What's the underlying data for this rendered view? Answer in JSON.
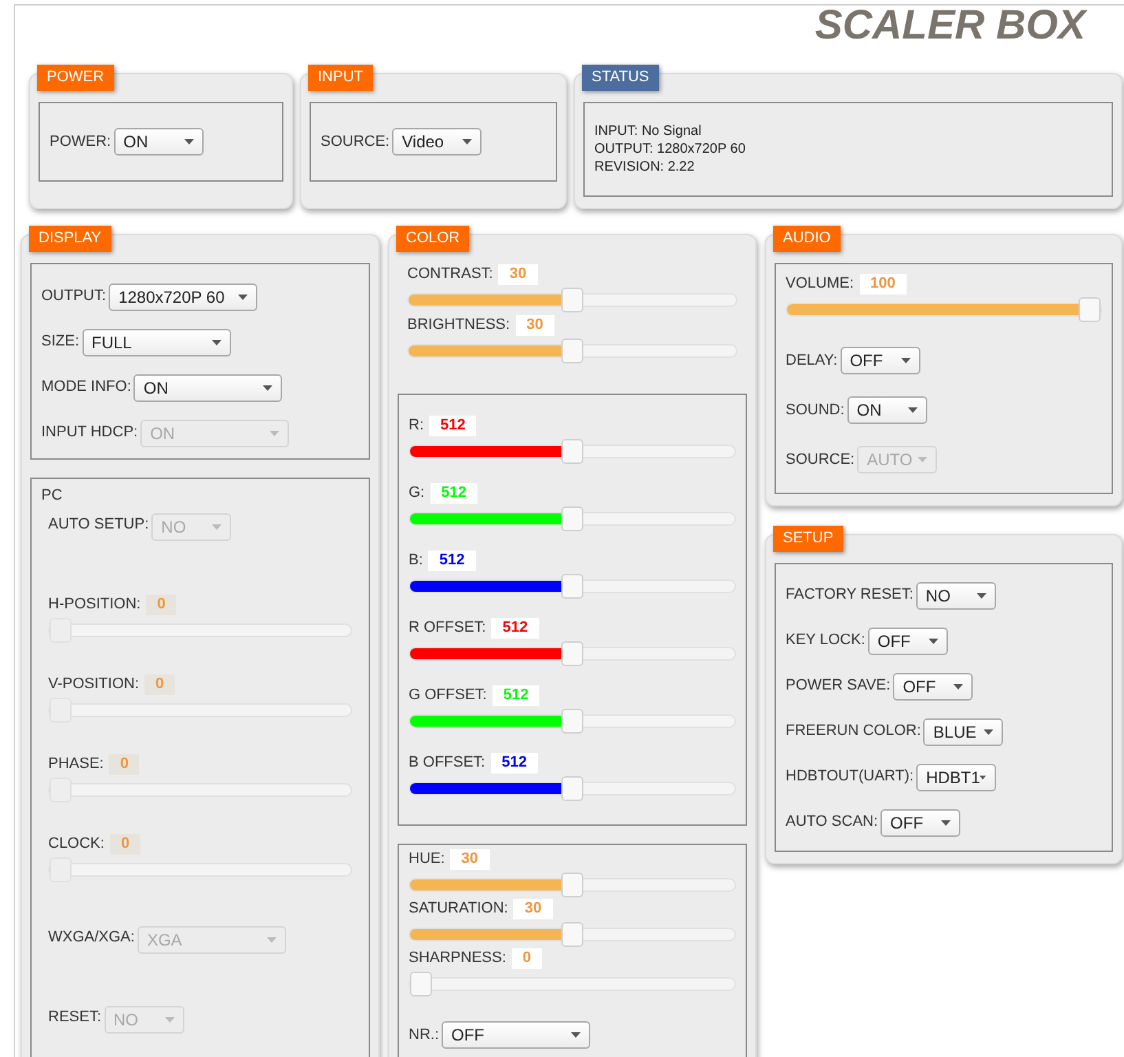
{
  "title": "SCALER BOX",
  "panels": [
    {
      "heading": "POWER",
      "color": "#ff6a00",
      "groups": [
        {
          "kind": "boxed",
          "rows": [
            {
              "kind": "select",
              "label": "POWER:",
              "value": "ON",
              "disabled": false
            }
          ]
        }
      ]
    },
    {
      "heading": "INPUT",
      "color": "#ff6a00",
      "groups": [
        {
          "kind": "boxed",
          "rows": [
            {
              "kind": "select",
              "label": "SOURCE:",
              "value": "Video",
              "disabled": false
            }
          ]
        }
      ]
    },
    {
      "heading": "STATUS",
      "color": "#4c6d9e",
      "groups": [
        {
          "kind": "boxed",
          "rows": [
            {
              "kind": "text",
              "label": "INPUT: No Signal"
            },
            {
              "kind": "text",
              "label": "OUTPUT: 1280x720P 60"
            },
            {
              "kind": "text",
              "label": "REVISION: 2.22"
            }
          ]
        }
      ]
    },
    {
      "heading": "DISPLAY",
      "color": "#ff6a00",
      "groups": [
        {
          "kind": "boxed",
          "rows": [
            {
              "kind": "select",
              "label": "OUTPUT:",
              "value": "1280x720P 60",
              "disabled": false
            },
            {
              "kind": "select",
              "label": "SIZE:",
              "value": "FULL",
              "disabled": false
            },
            {
              "kind": "select",
              "label": "MODE INFO:",
              "value": "ON",
              "disabled": false
            },
            {
              "kind": "select",
              "label": "INPUT HDCP:",
              "value": "ON",
              "disabled": true
            }
          ]
        },
        {
          "kind": "boxed",
          "title": "PC",
          "rows": [
            {
              "kind": "select",
              "label": "AUTO SETUP:",
              "value": "NO",
              "disabled": true
            },
            {
              "kind": "slider",
              "label": "H-POSITION:",
              "value": "0",
              "level": 0,
              "disabled": true
            },
            {
              "kind": "slider",
              "label": "V-POSITION:",
              "value": "0",
              "level": 0,
              "disabled": true
            },
            {
              "kind": "slider",
              "label": "PHASE:",
              "value": "0",
              "level": 0,
              "disabled": true
            },
            {
              "kind": "slider",
              "label": "CLOCK:",
              "value": "0",
              "level": 0,
              "disabled": true
            },
            {
              "kind": "select",
              "label": "WXGA/XGA:",
              "value": "XGA",
              "disabled": true
            },
            {
              "kind": "select",
              "label": "RESET:",
              "value": "NO",
              "disabled": true
            }
          ]
        }
      ]
    },
    {
      "heading": "COLOR",
      "color": "#ff6a00",
      "groups": [
        {
          "kind": "open",
          "rows": [
            {
              "kind": "slider",
              "label": "CONTRAST:",
              "value": "30",
              "level": 0.5,
              "color": "#f5b553",
              "disabled": false
            },
            {
              "kind": "slider",
              "label": "BRIGHTNESS:",
              "value": "30",
              "level": 0.5,
              "color": "#f5b553",
              "disabled": false
            }
          ]
        },
        {
          "kind": "boxed",
          "rows": [
            {
              "kind": "slider",
              "label": "R:",
              "value": "512",
              "level": 0.5,
              "color": "#ff0000",
              "disabled": false
            },
            {
              "kind": "slider",
              "label": "G:",
              "value": "512",
              "level": 0.5,
              "color": "#00ff00",
              "disabled": false
            },
            {
              "kind": "slider",
              "label": "B:",
              "value": "512",
              "level": 0.5,
              "color": "#0000ff",
              "disabled": false
            },
            {
              "kind": "slider",
              "label": "R OFFSET:",
              "value": "512",
              "level": 0.5,
              "color": "#ff0000",
              "disabled": false
            },
            {
              "kind": "slider",
              "label": "G OFFSET:",
              "value": "512",
              "level": 0.5,
              "color": "#00ff00",
              "disabled": false
            },
            {
              "kind": "slider",
              "label": "B OFFSET:",
              "value": "512",
              "level": 0.5,
              "color": "#0000ff",
              "disabled": false
            }
          ]
        },
        {
          "kind": "boxed",
          "rows": [
            {
              "kind": "slider",
              "label": "HUE:",
              "value": "30",
              "level": 0.5,
              "color": "#f5b553",
              "disabled": false
            },
            {
              "kind": "slider",
              "label": "SATURATION:",
              "value": "30",
              "level": 0.5,
              "color": "#f5b553",
              "disabled": false
            },
            {
              "kind": "slider",
              "label": "SHARPNESS:",
              "value": "0",
              "level": 0,
              "disabled": false
            },
            {
              "kind": "select",
              "label": "NR.:",
              "value": "OFF",
              "disabled": false
            }
          ]
        }
      ]
    },
    {
      "heading": "AUDIO",
      "color": "#ff6a00",
      "groups": [
        {
          "kind": "boxed",
          "rows": [
            {
              "kind": "slider",
              "label": "VOLUME:",
              "value": "100",
              "level": 1,
              "color": "#f5b553",
              "disabled": false
            },
            {
              "kind": "select",
              "label": "DELAY:",
              "value": "OFF",
              "disabled": false
            },
            {
              "kind": "select",
              "label": "SOUND:",
              "value": "ON",
              "disabled": false
            },
            {
              "kind": "select",
              "label": "SOURCE:",
              "value": "AUTO",
              "disabled": true
            }
          ]
        }
      ]
    },
    {
      "heading": "SETUP",
      "color": "#ff6a00",
      "groups": [
        {
          "kind": "boxed",
          "rows": [
            {
              "kind": "select",
              "label": "FACTORY RESET:",
              "value": "NO",
              "disabled": false
            },
            {
              "kind": "select",
              "label": "KEY LOCK:",
              "value": "OFF",
              "disabled": false
            },
            {
              "kind": "select",
              "label": "POWER SAVE:",
              "value": "OFF",
              "disabled": false
            },
            {
              "kind": "select",
              "label": "FREERUN COLOR:",
              "value": "BLUE",
              "disabled": false
            },
            {
              "kind": "select",
              "label": "HDBTOUT(UART):",
              "value": "HDBT1",
              "disabled": false
            },
            {
              "kind": "select",
              "label": "AUTO SCAN:",
              "value": "OFF",
              "disabled": false
            }
          ]
        }
      ]
    }
  ]
}
